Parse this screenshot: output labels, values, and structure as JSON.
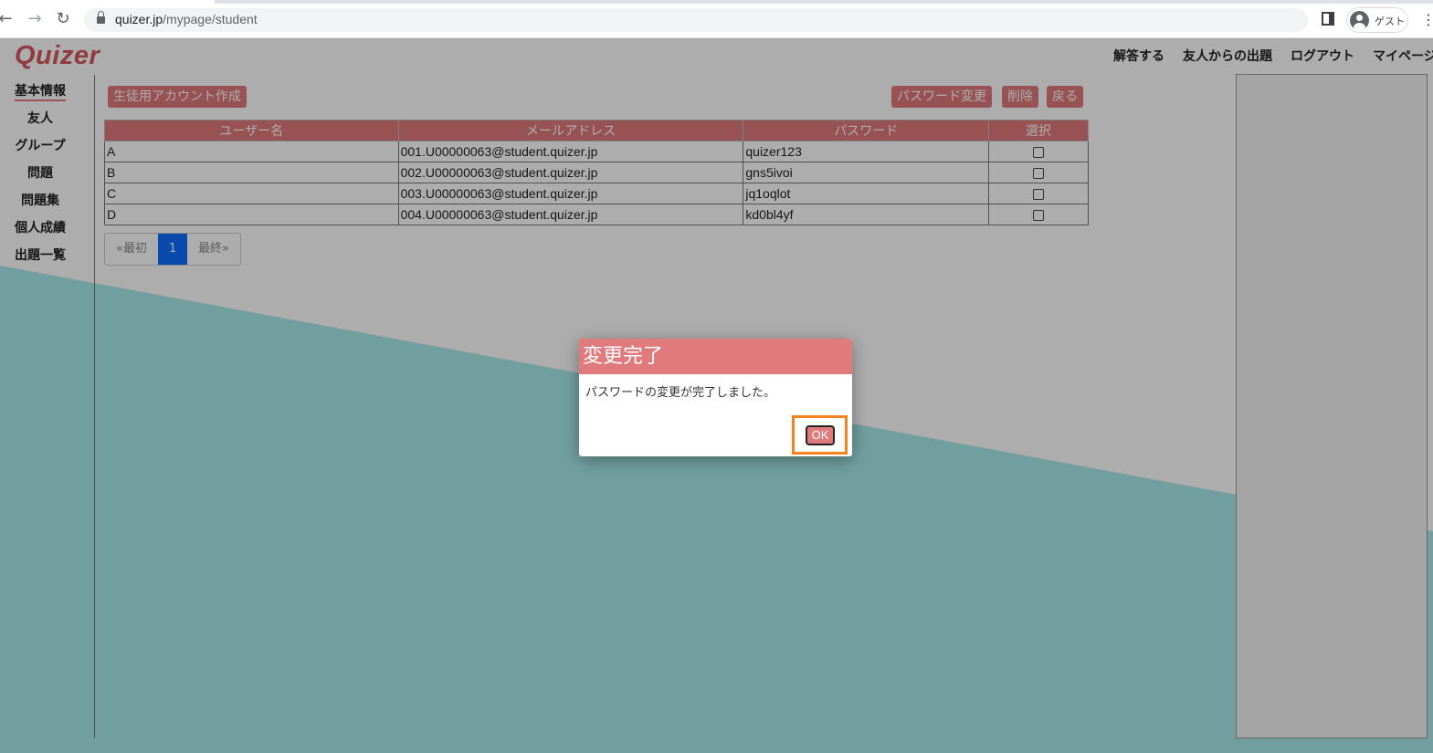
{
  "browser": {
    "url_domain": "quizer.jp",
    "url_path": "/mypage/student",
    "profile_label": "ゲスト"
  },
  "header": {
    "logo": "Quizer",
    "nav": [
      "解答する",
      "友人からの出題",
      "ログアウト",
      "マイページ"
    ]
  },
  "sidebar": {
    "items": [
      {
        "label": "基本情報",
        "active": true
      },
      {
        "label": "友人",
        "active": false
      },
      {
        "label": "グループ",
        "active": false
      },
      {
        "label": "問題",
        "active": false
      },
      {
        "label": "問題集",
        "active": false
      },
      {
        "label": "個人成績",
        "active": false
      },
      {
        "label": "出題一覧",
        "active": false
      }
    ]
  },
  "toolbar": {
    "create_label": "生徒用アカウント作成",
    "change_password_label": "パスワード変更",
    "delete_label": "削除",
    "back_label": "戻る"
  },
  "table": {
    "headers": [
      "ユーザー名",
      "メールアドレス",
      "パスワード",
      "選択"
    ],
    "rows": [
      {
        "username": "A",
        "email": "001.U00000063@student.quizer.jp",
        "password": "quizer123",
        "selected": false
      },
      {
        "username": "B",
        "email": "002.U00000063@student.quizer.jp",
        "password": "gns5ivoi",
        "selected": false
      },
      {
        "username": "C",
        "email": "003.U00000063@student.quizer.jp",
        "password": "jq1oqlot",
        "selected": false
      },
      {
        "username": "D",
        "email": "004.U00000063@student.quizer.jp",
        "password": "kd0bl4yf",
        "selected": false
      }
    ]
  },
  "pagination": {
    "first_label": "«最初",
    "current_page": "1",
    "last_label": "最終»"
  },
  "dialog": {
    "title": "変更完了",
    "message": "パスワードの変更が完了しました。",
    "ok_label": "OK"
  },
  "colors": {
    "accent": "#e07a7c",
    "logo": "#d4575a",
    "teal_background": "#a7ebea",
    "pager_active": "#0d6efd",
    "highlight_frame": "#f5821f"
  }
}
